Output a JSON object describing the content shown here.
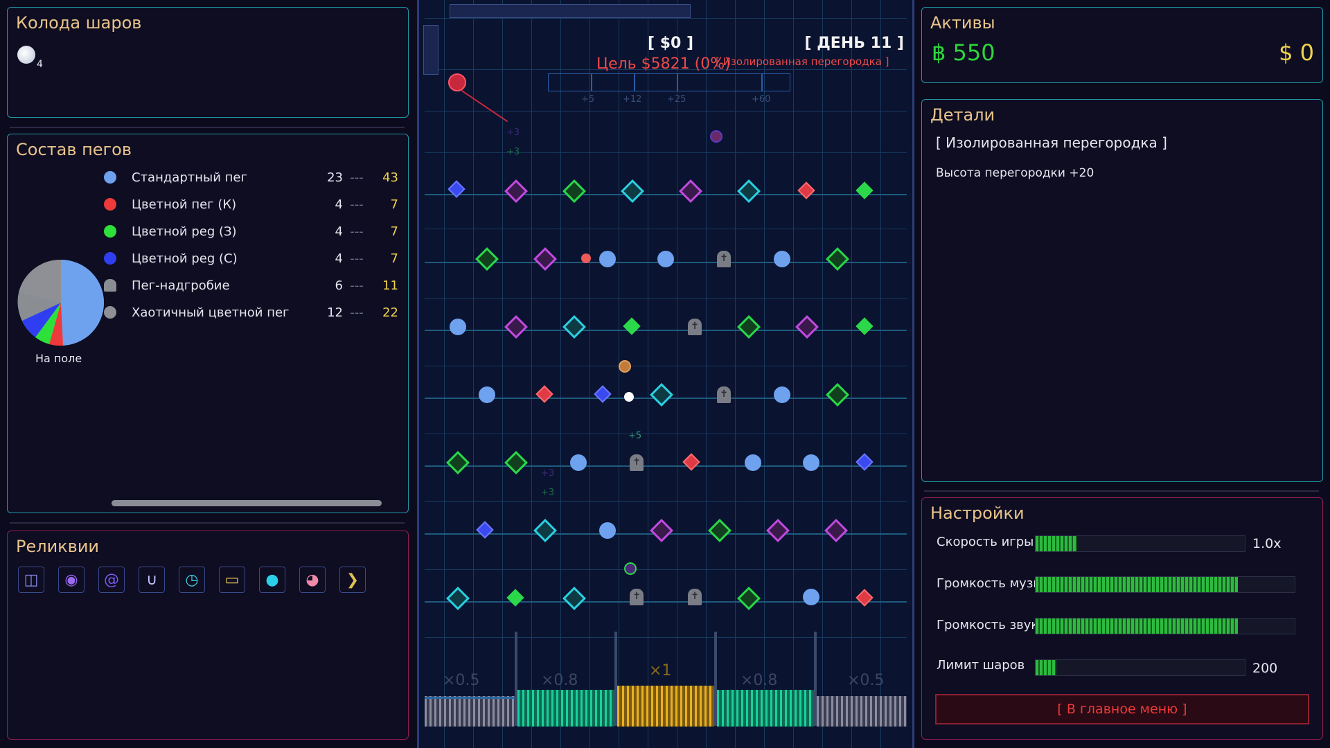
{
  "deck": {
    "title": "Колода шаров",
    "ball_count": "4"
  },
  "pegs": {
    "title": "Состав пегов",
    "pie_label": "На поле",
    "items": [
      {
        "name": "Стандартный пег",
        "count": "23",
        "dash": "---",
        "total": "43",
        "color": "#6ea2ee"
      },
      {
        "name": "Цветной пег (К)",
        "count": "4",
        "dash": "---",
        "total": "7",
        "color": "#ee3a3a"
      },
      {
        "name": "Цветной peg (З)",
        "count": "4",
        "dash": "---",
        "total": "7",
        "color": "#2ee03a"
      },
      {
        "name": "Цветной peg (С)",
        "count": "4",
        "dash": "---",
        "total": "7",
        "color": "#2f3ef0"
      },
      {
        "name": "Пег-надгробие",
        "count": "6",
        "dash": "---",
        "total": "11",
        "color": "#8a8d92"
      },
      {
        "name": "Хаотичный цветной пег",
        "count": "12",
        "dash": "---",
        "total": "22",
        "color": "#8f9095"
      }
    ]
  },
  "relics": {
    "title": "Реликвии",
    "items": [
      "rune-relic",
      "dark-orb-relic",
      "spiral-relic",
      "magnet-relic",
      "clock-relic",
      "card-relic",
      "cyan-orb-relic",
      "pig-relic",
      "arrow-relic"
    ]
  },
  "hud": {
    "money": "[ $0 ]",
    "day": "[ ДЕНЬ 11 ]",
    "goal": "Цель $5821  (0%)",
    "hover_label": "[ Изолированная перегородка ]",
    "goal_ticks": [
      "+5",
      "+12",
      "+25",
      "+60"
    ],
    "multipliers": [
      "×0.5",
      "×0.8",
      "×1",
      "×0.8",
      "×0.5"
    ],
    "float_texts": [
      "+3",
      "+3",
      "+5",
      "+3",
      "+3"
    ]
  },
  "assets": {
    "title": "Активы",
    "coins": "฿ 550",
    "dollars": "$ 0"
  },
  "details": {
    "title": "Детали",
    "item_name": "[ Изолированная перегородка ]",
    "effect": "Высота перегородки +20"
  },
  "settings": {
    "title": "Настройки",
    "game_speed": {
      "label": "Скорость игры",
      "value": "1.0x",
      "level": 0.2
    },
    "music": {
      "label": "Громкость музыки",
      "level": 0.78
    },
    "sound": {
      "label": "Громкость звука",
      "level": 0.78
    },
    "ball_limit": {
      "label": "Лимит шаров",
      "value": "200",
      "level": 0.1
    },
    "main_menu": "[ В главное меню ]"
  },
  "colors": {
    "accent_cyan": "#1f9aa6",
    "panel_pink": "#8e2052",
    "gold": "#e9c48b",
    "green": "#2dd63a",
    "yellow": "#f2d44c",
    "red": "#ee4a4a"
  }
}
